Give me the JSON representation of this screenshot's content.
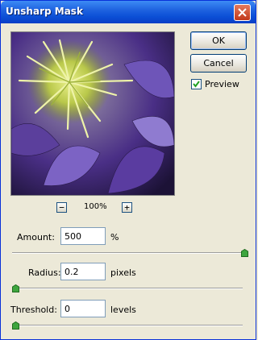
{
  "window": {
    "title": "Unsharp Mask"
  },
  "buttons": {
    "ok": "OK",
    "cancel": "Cancel"
  },
  "preview_toggle": {
    "label": "Preview",
    "checked": true
  },
  "zoom": {
    "level": "100%",
    "minus": "−",
    "plus": "+"
  },
  "amount": {
    "label": "Amount:",
    "value": "500",
    "unit": "%",
    "slider_level": 1.0
  },
  "radius": {
    "label": "Radius:",
    "value": "0.2",
    "unit": "pixels",
    "slider_level": 0.0
  },
  "threshold": {
    "label": "Threshold:",
    "value": "0",
    "unit": "levels",
    "slider_level": 0.0
  },
  "colors": {
    "title_bar": "#0b4fd6",
    "dialog_bg": "#ece9d8",
    "slider_thumb": "#3ea53e"
  }
}
